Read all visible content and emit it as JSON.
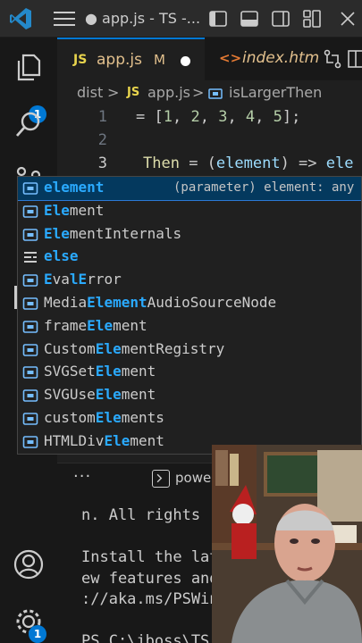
{
  "titlebar": {
    "title": "● app.js - TS -..."
  },
  "activitybar": {
    "explorer_badge": "1",
    "settings_badge": "1"
  },
  "tabs": [
    {
      "icon": "JS",
      "label": "app.js",
      "status": "M"
    },
    {
      "icon": "<>",
      "label": "index.html"
    }
  ],
  "breadcrumb": {
    "folder": "dist",
    "sep": ">",
    "file_icon": "JS",
    "file": "app.js",
    "symbol": "isLargerThen"
  },
  "editor": {
    "lines": [
      {
        "number": "1",
        "code_prefix": "= [",
        "nums": [
          "1",
          "2",
          "3",
          "4",
          "5"
        ],
        "code_suffix": "];"
      },
      {
        "number": "2"
      },
      {
        "number": "3",
        "fn_tail": "Then",
        "eq": " = (",
        "param": "element",
        "arrow": ") => ",
        "typed": "ele"
      }
    ]
  },
  "suggest": {
    "detail": "(parameter) element: any",
    "items": [
      {
        "pre": "",
        "hl": "element",
        "post": "",
        "kind": "variable"
      },
      {
        "pre": "",
        "hl": "Ele",
        "post": "ment",
        "kind": "variable"
      },
      {
        "pre": "",
        "hl": "Ele",
        "post": "mentInternals",
        "kind": "variable"
      },
      {
        "pre": "",
        "hl": "else",
        "post": "",
        "kind": "keyword"
      },
      {
        "pre": "",
        "hl": "E",
        "post": "va",
        "hl2": "l",
        "post2": "",
        "hl3": "E",
        "post3": "rror",
        "kind": "variable"
      },
      {
        "pre": "Media",
        "hl": "Element",
        "post": "AudioSourceNode",
        "kind": "variable"
      },
      {
        "pre": "frame",
        "hl": "Ele",
        "post": "ment",
        "kind": "variable"
      },
      {
        "pre": "Custom",
        "hl": "Ele",
        "post": "mentRegistry",
        "kind": "variable"
      },
      {
        "pre": "SVGSet",
        "hl": "Ele",
        "post": "ment",
        "kind": "variable"
      },
      {
        "pre": "SVGUse",
        "hl": "Ele",
        "post": "ment",
        "kind": "variable"
      },
      {
        "pre": "custom",
        "hl": "Ele",
        "post": "ments",
        "kind": "variable"
      },
      {
        "pre": "HTMLDiv",
        "hl": "Ele",
        "post": "ment",
        "kind": "variable"
      }
    ]
  },
  "panel": {
    "more": "···",
    "terminal_tab": "powe"
  },
  "terminal": {
    "lines": [
      "n. All rights r",
      "",
      "Install the lat",
      "ew features and",
      "://aka.ms/PSWin",
      "",
      "PS C:\\jboss\\TS"
    ]
  },
  "colors": {
    "accent": "#0078d4",
    "highlight": "#2aaaff",
    "selection": "#04395e"
  }
}
